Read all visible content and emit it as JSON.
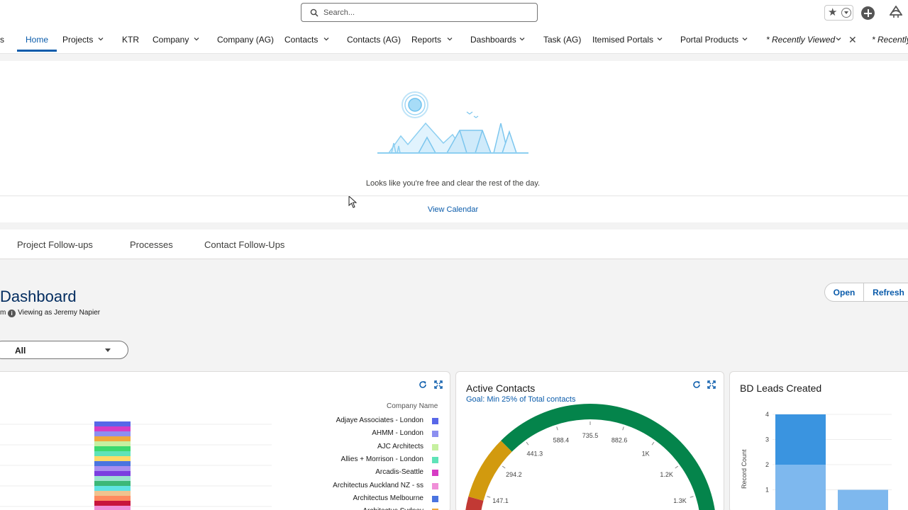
{
  "header": {
    "search_placeholder": "Search..."
  },
  "nav": {
    "partial_left": "s",
    "items": [
      {
        "label": "Home"
      },
      {
        "label": "Projects"
      },
      {
        "label": "KTR"
      },
      {
        "label": "Company"
      },
      {
        "label": "Company (AG)"
      },
      {
        "label": "Contacts"
      },
      {
        "label": "Contacts (AG)"
      },
      {
        "label": "Reports"
      },
      {
        "label": "Dashboards"
      },
      {
        "label": "Task (AG)"
      },
      {
        "label": "Itemised Portals"
      },
      {
        "label": "Portal Products"
      },
      {
        "label": "* Recently Viewed"
      },
      {
        "label": "* Recently"
      }
    ]
  },
  "events": {
    "empty_message": "Looks like you're free and clear the rest of the day.",
    "view_calendar_label": "View Calendar"
  },
  "tabs": [
    {
      "label": "Project Follow-ups"
    },
    {
      "label": "Processes"
    },
    {
      "label": "Contact Follow-Ups"
    }
  ],
  "dashboard": {
    "title": "Dashboard",
    "subtitle_partial": "m",
    "viewing_as": "Viewing as Jeremy Napier",
    "open_label": "Open",
    "refresh_label": "Refresh",
    "filter_value": "All"
  },
  "widget_company": {
    "legend_title": "Company Name",
    "legend": [
      {
        "name": "Adjaye Associates - London",
        "color": "#5867e8"
      },
      {
        "name": "AHMM - London",
        "color": "#8c8ff0"
      },
      {
        "name": "AJC Architects",
        "color": "#c6f0a0"
      },
      {
        "name": "Allies + Morrison - London",
        "color": "#5fe3b8"
      },
      {
        "name": "Arcadis-Seattle",
        "color": "#d63cc4"
      },
      {
        "name": "Architectus Auckland NZ - ss",
        "color": "#f08fd8"
      },
      {
        "name": "Architectus Melbourne",
        "color": "#4a74e0"
      },
      {
        "name": "Architectus Sydney",
        "color": "#f0a83c"
      }
    ],
    "stack_colors": [
      "#5867e8",
      "#d63cc4",
      "#8c8ff0",
      "#f0a83c",
      "#c6f0a0",
      "#3cd96e",
      "#5fe3b8",
      "#ffd966",
      "#4a74e0",
      "#a98ff0",
      "#7b3fe0",
      "#9be3d0",
      "#3cb878",
      "#5fe3e3",
      "#f0c38f",
      "#ff8a5f",
      "#c8143c",
      "#f08fd8",
      "#e07080"
    ]
  },
  "widget_active": {
    "title": "Active Contacts",
    "goal": "Goal: Min 25% of Total contacts",
    "ticks": [
      "147.1",
      "294.2",
      "441.3",
      "588.4",
      "735.5",
      "882.6",
      "1K",
      "1.2K",
      "1.3K"
    ],
    "band_colors": [
      "#c23934",
      "#d29a0e",
      "#04844b"
    ]
  },
  "widget_bd": {
    "title": "BD Leads Created",
    "ylabel": "Record Count",
    "yticks": [
      "1",
      "2",
      "3",
      "4"
    ],
    "chart_data": {
      "type": "bar",
      "ylabel": "Record Count",
      "ylim": [
        0,
        4
      ],
      "series": [
        {
          "values": [
            4,
            1
          ]
        }
      ],
      "stack_split": [
        2,
        1
      ]
    }
  }
}
